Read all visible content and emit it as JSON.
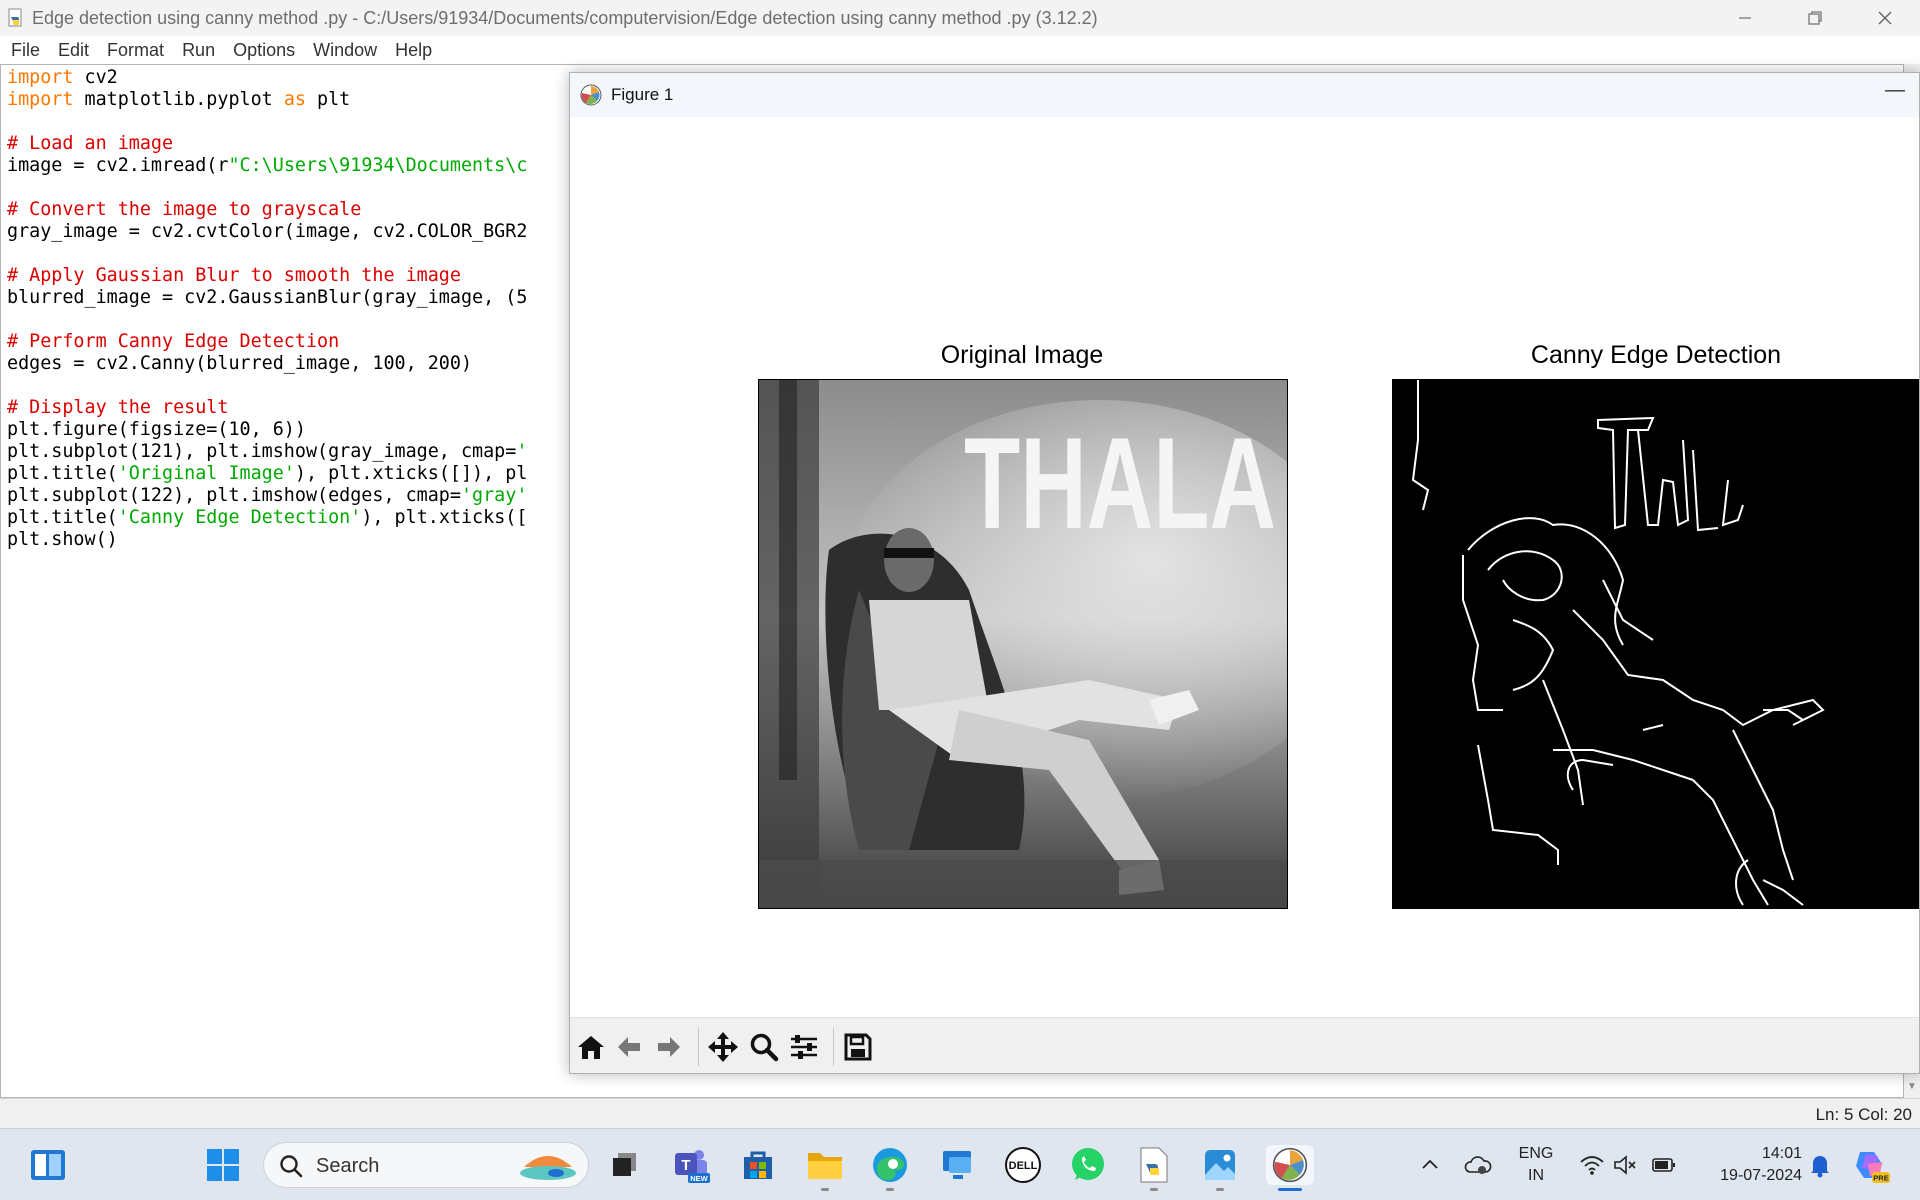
{
  "window": {
    "title": "Edge detection using canny method .py - C:/Users/91934/Documents/computervision/Edge detection using canny method .py (3.12.2)"
  },
  "menu": [
    "File",
    "Edit",
    "Format",
    "Run",
    "Options",
    "Window",
    "Help"
  ],
  "editor": {
    "lines": [
      [
        [
          "kw",
          "import"
        ],
        [
          "t",
          " cv2"
        ]
      ],
      [
        [
          "kw",
          "import"
        ],
        [
          "t",
          " matplotlib.pyplot "
        ],
        [
          "kw",
          "as"
        ],
        [
          "t",
          " plt"
        ]
      ],
      [
        [
          "t",
          ""
        ]
      ],
      [
        [
          "cm",
          "# Load an image"
        ]
      ],
      [
        [
          "t",
          "image = cv2.imread(r"
        ],
        [
          "st",
          "\"C:\\Users\\91934\\Documents\\c"
        ]
      ],
      [
        [
          "t",
          ""
        ]
      ],
      [
        [
          "cm",
          "# Convert the image to grayscale"
        ]
      ],
      [
        [
          "t",
          "gray_image = cv2.cvtColor(image, cv2.COLOR_BGR2"
        ]
      ],
      [
        [
          "t",
          ""
        ]
      ],
      [
        [
          "cm",
          "# Apply Gaussian Blur to smooth the image"
        ]
      ],
      [
        [
          "t",
          "blurred_image = cv2.GaussianBlur(gray_image, (5"
        ]
      ],
      [
        [
          "t",
          ""
        ]
      ],
      [
        [
          "cm",
          "# Perform Canny Edge Detection"
        ]
      ],
      [
        [
          "t",
          "edges = cv2.Canny(blurred_image, 100, 200)"
        ]
      ],
      [
        [
          "t",
          ""
        ]
      ],
      [
        [
          "cm",
          "# Display the result"
        ]
      ],
      [
        [
          "t",
          "plt.figure(figsize=(10, 6))"
        ]
      ],
      [
        [
          "t",
          "plt.subplot(121), plt.imshow(gray_image, cmap="
        ],
        [
          "st",
          "'"
        ]
      ],
      [
        [
          "t",
          "plt.title("
        ],
        [
          "st",
          "'Original Image'"
        ],
        [
          "t",
          "), plt.xticks([]), pl"
        ]
      ],
      [
        [
          "t",
          "plt.subplot(122), plt.imshow(edges, cmap="
        ],
        [
          "st",
          "'gray'"
        ]
      ],
      [
        [
          "t",
          "plt.title("
        ],
        [
          "st",
          "'Canny Edge Detection'"
        ],
        [
          "t",
          "), plt.xticks(["
        ]
      ],
      [
        [
          "t",
          "plt.show()"
        ]
      ]
    ]
  },
  "status": {
    "position": "Ln: 5   Col: 20"
  },
  "figure": {
    "window_title": "Figure 1",
    "left_title": "Original Image",
    "right_title": "Canny Edge Detection",
    "image_text": "THALA",
    "toolbar": [
      "home-icon",
      "back-arrow-icon",
      "forward-arrow-icon",
      "pan-icon",
      "zoom-icon",
      "configure-subplots-icon",
      "save-icon"
    ]
  },
  "taskbar": {
    "search_label": "Search",
    "lang_line1": "ENG",
    "lang_line2": "IN",
    "time": "14:01",
    "date": "19-07-2024",
    "teams_badge": "NEW",
    "copilot_badge": "PRE",
    "dell_label": "DELL"
  }
}
